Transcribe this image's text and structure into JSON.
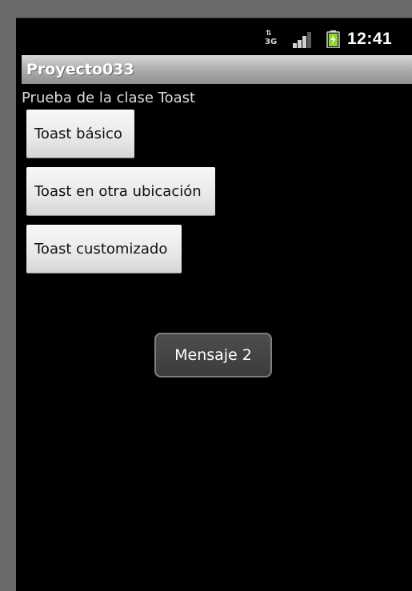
{
  "status_bar": {
    "network_icon": "3g-data-icon",
    "network_type": "3G",
    "data_arrows": "⇅",
    "signal_icon": "signal-strength-icon",
    "battery_icon": "battery-charging-icon",
    "time": "12:41"
  },
  "app": {
    "title": "Proyecto033"
  },
  "content": {
    "label": "Prueba de la clase Toast",
    "buttons": [
      {
        "label": "Toast básico"
      },
      {
        "label": "Toast en otra ubicación"
      },
      {
        "label": "Toast customizado"
      }
    ]
  },
  "toast": {
    "message": "Mensaje 2"
  },
  "colors": {
    "screen_background": "#000000",
    "frame": "#6a6a6a",
    "title_bar_top": "#d6d6d6",
    "title_bar_bottom": "#8f8f8f",
    "battery_charge": "#8bd62f",
    "toast_background": "#444444"
  }
}
